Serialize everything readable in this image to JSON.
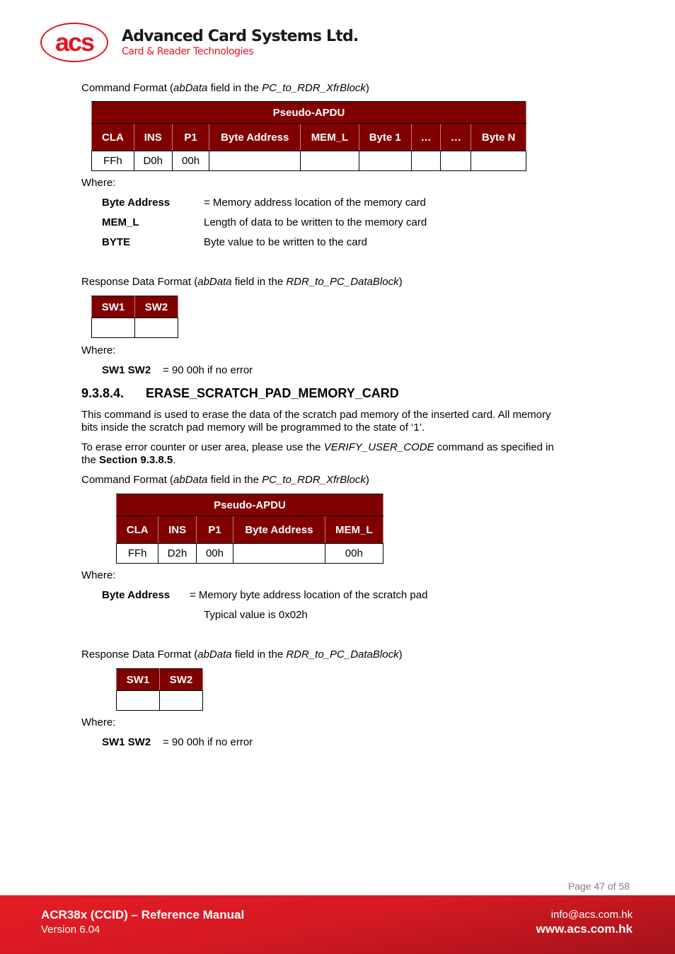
{
  "header": {
    "logo_text": "acs",
    "company_name": "Advanced Card Systems Ltd.",
    "tagline": "Card & Reader Technologies"
  },
  "section1": {
    "command_format": {
      "prefix": "Command Format (",
      "field": "abData",
      "middle": " field in the ",
      "block": "PC_to_RDR_XfrBlock",
      "suffix": ")"
    },
    "apdu_table": {
      "title": "Pseudo-APDU",
      "headers": [
        "CLA",
        "INS",
        "P1",
        "Byte Address",
        "MEM_L",
        "Byte 1",
        "…",
        "…",
        "Byte N"
      ],
      "row": [
        "FFh",
        "D0h",
        "00h",
        "",
        "",
        "",
        "",
        "",
        ""
      ]
    },
    "where_label": "Where:",
    "definitions": [
      {
        "term": "Byte Address",
        "desc": "= Memory address location of the memory card"
      },
      {
        "term": "MEM_L",
        "desc": "Length of data to be written to the memory card"
      },
      {
        "term": "BYTE",
        "desc": "Byte value to be written to the card"
      }
    ],
    "response_format": {
      "prefix": "Response Data Format (",
      "field": "abData",
      "middle": " field in the ",
      "block": "RDR_to_PC_DataBlock",
      "suffix": ")"
    },
    "response_table": {
      "headers": [
        "SW1",
        "SW2"
      ],
      "row": [
        "",
        ""
      ]
    },
    "where2_label": "Where:",
    "sw_def": {
      "term": "SW1 SW2",
      "desc": "= 90 00h if no error"
    }
  },
  "section2": {
    "number": "9.3.8.4.",
    "title": "ERASE_SCRATCH_PAD_MEMORY_CARD",
    "para1_line1": "This command is used to erase the data of the scratch pad memory of the inserted card. All memory",
    "para1_line2": "bits inside the scratch pad memory will be programmed to the state of ‘1’.",
    "para2": {
      "prefix": "To erase error counter or user area, please use the ",
      "cmd": "VERIFY_USER_CODE",
      "suffix": " command as specified in",
      "line2_prefix": "the ",
      "section_ref": "Section 9.3.8.5",
      "line2_suffix": "."
    },
    "command_format": {
      "prefix": "Command Format (",
      "field": "abData",
      "middle": " field in the ",
      "block": "PC_to_RDR_XfrBlock",
      "suffix": ")"
    },
    "apdu_table": {
      "title": "Pseudo-APDU",
      "headers": [
        "CLA",
        "INS",
        "P1",
        "Byte Address",
        "MEM_L"
      ],
      "row": [
        "FFh",
        "D2h",
        "00h",
        "",
        "00h"
      ]
    },
    "where_label": "Where:",
    "byte_address_def": {
      "term": "Byte Address",
      "desc": "= Memory byte address location of the scratch pad",
      "note": "Typical value is 0x02h"
    },
    "response_format": {
      "prefix": "Response Data Format (",
      "field": "abData",
      "middle": " field in the ",
      "block": "RDR_to_PC_DataBlock",
      "suffix": ")"
    },
    "response_table": {
      "headers": [
        "SW1",
        "SW2"
      ],
      "row": [
        "",
        ""
      ]
    },
    "where2_label": "Where:",
    "sw_def": {
      "term": "SW1 SW2",
      "desc": "= 90 00h if no error"
    }
  },
  "footer": {
    "page": "Page 47 of 58",
    "manual_title": "ACR38x (CCID) – Reference Manual",
    "version": "Version 6.04",
    "email": "info@acs.com.hk",
    "website": "www.acs.com.hk",
    "brand_color": "#e41c24",
    "table_header_color": "#800000"
  }
}
